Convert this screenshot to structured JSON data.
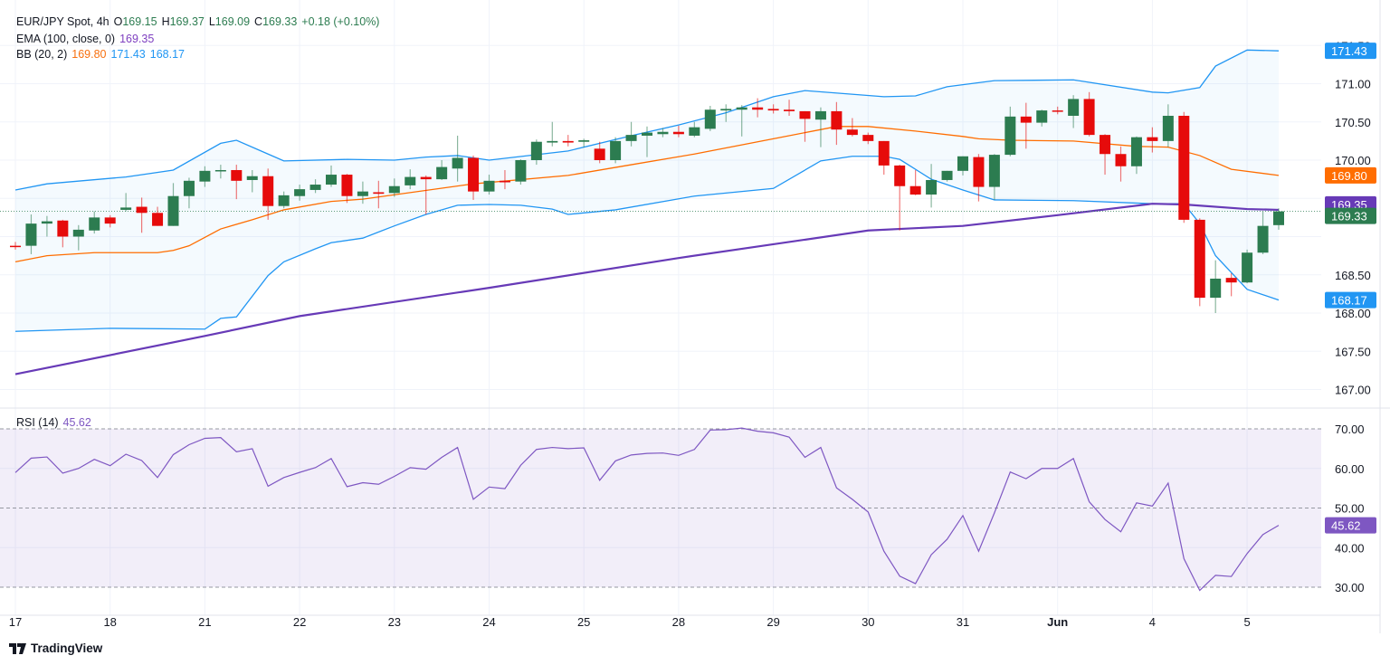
{
  "legend": {
    "symbol": "EUR/JPY Spot, 4h",
    "o_label": "O",
    "open": "169.15",
    "h_label": "H",
    "high": "169.37",
    "l_label": "L",
    "low": "169.09",
    "c_label": "C",
    "close": "169.33",
    "change": "+0.18 (+0.10%)",
    "ema_label": "EMA (100, close, 0)",
    "ema_value": "169.35",
    "bb_label": "BB (20, 2)",
    "bb_basis": "169.80",
    "bb_upper": "171.43",
    "bb_lower": "168.17",
    "rsi_label": "RSI (14)",
    "rsi_value": "45.62"
  },
  "branding": {
    "name": "TradingView"
  },
  "colors": {
    "up": "#2c7c50",
    "down": "#e60b0b",
    "bb_band": "#2196f3",
    "bb_basis": "#ff6d00",
    "ema": "#673ab7",
    "rsi": "#7e57c2"
  },
  "chart_data": [
    {
      "type": "candlestick",
      "x_tick_labels": [
        "17",
        "18",
        "21",
        "22",
        "23",
        "24",
        "25",
        "28",
        "29",
        "30",
        "31",
        "Jun",
        "4",
        "5"
      ],
      "y_tick_labels": [
        "171.50",
        "171.00",
        "170.50",
        "170.00",
        "168.50",
        "168.00",
        "167.50",
        "167.00"
      ],
      "ylim": [
        166.8,
        171.6
      ],
      "grid": true,
      "price_labels": {
        "bb_upper": "171.43",
        "bb_basis": "169.80",
        "ema": "169.35",
        "last": "169.33",
        "bb_lower": "168.17"
      },
      "candles_ohlc": [
        [
          168.88,
          168.93,
          168.83,
          168.87
        ],
        [
          168.88,
          169.29,
          168.77,
          169.17
        ],
        [
          169.17,
          169.27,
          169.0,
          169.2
        ],
        [
          169.21,
          169.22,
          168.86,
          169.0
        ],
        [
          169.0,
          169.15,
          168.82,
          169.09
        ],
        [
          169.08,
          169.33,
          169.04,
          169.25
        ],
        [
          169.25,
          169.28,
          169.12,
          169.17
        ],
        [
          169.35,
          169.57,
          169.33,
          169.38
        ],
        [
          169.39,
          169.51,
          169.05,
          169.31
        ],
        [
          169.31,
          169.39,
          169.14,
          169.14
        ],
        [
          169.14,
          169.7,
          169.14,
          169.53
        ],
        [
          169.53,
          169.77,
          169.37,
          169.73
        ],
        [
          169.72,
          169.92,
          169.65,
          169.86
        ],
        [
          169.86,
          169.94,
          169.76,
          169.87
        ],
        [
          169.87,
          169.94,
          169.49,
          169.73
        ],
        [
          169.74,
          169.87,
          169.58,
          169.79
        ],
        [
          169.79,
          169.89,
          169.22,
          169.4
        ],
        [
          169.4,
          169.59,
          169.37,
          169.54
        ],
        [
          169.53,
          169.68,
          169.47,
          169.62
        ],
        [
          169.61,
          169.75,
          169.57,
          169.68
        ],
        [
          169.68,
          169.93,
          169.65,
          169.81
        ],
        [
          169.81,
          169.82,
          169.44,
          169.53
        ],
        [
          169.53,
          169.72,
          169.43,
          169.59
        ],
        [
          169.58,
          169.73,
          169.37,
          169.56
        ],
        [
          169.57,
          169.76,
          169.52,
          169.66
        ],
        [
          169.67,
          169.88,
          169.62,
          169.78
        ],
        [
          169.78,
          169.8,
          169.29,
          169.75
        ],
        [
          169.75,
          170.0,
          169.74,
          169.91
        ],
        [
          169.89,
          170.32,
          169.72,
          170.03
        ],
        [
          170.03,
          170.06,
          169.48,
          169.59
        ],
        [
          169.59,
          169.81,
          169.55,
          169.73
        ],
        [
          169.73,
          169.87,
          169.62,
          169.71
        ],
        [
          169.72,
          170.01,
          169.68,
          170.0
        ],
        [
          170.0,
          170.27,
          169.94,
          170.24
        ],
        [
          170.23,
          170.5,
          170.18,
          170.25
        ],
        [
          170.25,
          170.33,
          170.18,
          170.23
        ],
        [
          170.24,
          170.28,
          170.17,
          170.26
        ],
        [
          170.15,
          170.24,
          169.96,
          170.0
        ],
        [
          170.0,
          170.3,
          169.96,
          170.25
        ],
        [
          170.25,
          170.5,
          170.18,
          170.33
        ],
        [
          170.32,
          170.44,
          170.04,
          170.36
        ],
        [
          170.34,
          170.42,
          170.3,
          170.37
        ],
        [
          170.37,
          170.45,
          170.3,
          170.34
        ],
        [
          170.32,
          170.5,
          170.3,
          170.43
        ],
        [
          170.41,
          170.71,
          170.38,
          170.66
        ],
        [
          170.65,
          170.73,
          170.5,
          170.67
        ],
        [
          170.66,
          170.72,
          170.31,
          170.69
        ],
        [
          170.69,
          170.81,
          170.56,
          170.66
        ],
        [
          170.67,
          170.73,
          170.61,
          170.65
        ],
        [
          170.66,
          170.79,
          170.58,
          170.64
        ],
        [
          170.64,
          170.64,
          170.24,
          170.54
        ],
        [
          170.53,
          170.69,
          170.17,
          170.64
        ],
        [
          170.64,
          170.76,
          170.2,
          170.4
        ],
        [
          170.4,
          170.55,
          170.31,
          170.33
        ],
        [
          170.33,
          170.36,
          170.21,
          170.25
        ],
        [
          170.25,
          170.25,
          169.81,
          169.93
        ],
        [
          169.93,
          169.94,
          169.08,
          169.66
        ],
        [
          169.66,
          169.87,
          169.54,
          169.55
        ],
        [
          169.55,
          169.95,
          169.38,
          169.74
        ],
        [
          169.74,
          169.86,
          169.72,
          169.86
        ],
        [
          169.86,
          170.05,
          169.8,
          170.05
        ],
        [
          170.04,
          170.08,
          169.46,
          169.65
        ],
        [
          169.65,
          170.08,
          169.48,
          170.07
        ],
        [
          170.07,
          170.7,
          170.05,
          170.57
        ],
        [
          170.57,
          170.75,
          170.15,
          170.49
        ],
        [
          170.49,
          170.66,
          170.44,
          170.65
        ],
        [
          170.65,
          170.7,
          170.6,
          170.64
        ],
        [
          170.58,
          170.85,
          170.42,
          170.8
        ],
        [
          170.8,
          170.89,
          170.31,
          170.33
        ],
        [
          170.33,
          170.34,
          169.81,
          170.08
        ],
        [
          170.08,
          170.18,
          169.72,
          169.92
        ],
        [
          169.92,
          170.31,
          169.82,
          170.3
        ],
        [
          170.3,
          170.43,
          170.1,
          170.25
        ],
        [
          170.25,
          170.73,
          170.17,
          170.58
        ],
        [
          170.58,
          170.63,
          169.18,
          169.22
        ],
        [
          169.22,
          169.24,
          168.09,
          168.2
        ],
        [
          168.2,
          168.69,
          168.0,
          168.45
        ],
        [
          168.46,
          168.52,
          168.22,
          168.4
        ],
        [
          168.4,
          168.83,
          168.39,
          168.79
        ],
        [
          168.79,
          169.33,
          168.77,
          169.14
        ],
        [
          169.15,
          169.37,
          169.09,
          169.33
        ]
      ],
      "bb_upper": [
        [
          0,
          169.61
        ],
        [
          2,
          169.69
        ],
        [
          7,
          169.78
        ],
        [
          10,
          169.87
        ],
        [
          13,
          170.22
        ],
        [
          14,
          170.26
        ],
        [
          16,
          170.08
        ],
        [
          17,
          169.99
        ],
        [
          21,
          170.01
        ],
        [
          24,
          170.0
        ],
        [
          26,
          170.04
        ],
        [
          28,
          170.06
        ],
        [
          30,
          170.0
        ],
        [
          35,
          170.12
        ],
        [
          39,
          170.32
        ],
        [
          42,
          170.46
        ],
        [
          45,
          170.62
        ],
        [
          48,
          170.83
        ],
        [
          50,
          170.91
        ],
        [
          55,
          170.83
        ],
        [
          57,
          170.84
        ],
        [
          59,
          170.96
        ],
        [
          62,
          171.04
        ],
        [
          67,
          171.05
        ],
        [
          72,
          170.89
        ],
        [
          73,
          170.88
        ],
        [
          75,
          170.95
        ],
        [
          76,
          171.23
        ],
        [
          78,
          171.44
        ],
        [
          80,
          171.43
        ]
      ],
      "bb_basis": [
        [
          0,
          168.67
        ],
        [
          2,
          168.75
        ],
        [
          5,
          168.79
        ],
        [
          9,
          168.79
        ],
        [
          10,
          168.82
        ],
        [
          11,
          168.88
        ],
        [
          13,
          169.1
        ],
        [
          15,
          169.22
        ],
        [
          17,
          169.35
        ],
        [
          20,
          169.46
        ],
        [
          22,
          169.49
        ],
        [
          29,
          169.69
        ],
        [
          35,
          169.8
        ],
        [
          39,
          169.94
        ],
        [
          43,
          170.08
        ],
        [
          48,
          170.28
        ],
        [
          52,
          170.44
        ],
        [
          54,
          170.44
        ],
        [
          57,
          170.38
        ],
        [
          60,
          170.31
        ],
        [
          61,
          170.28
        ],
        [
          63,
          170.26
        ],
        [
          67,
          170.25
        ],
        [
          71,
          170.18
        ],
        [
          73,
          170.17
        ],
        [
          75,
          170.06
        ],
        [
          77,
          169.88
        ],
        [
          80,
          169.8
        ]
      ],
      "bb_lower": [
        [
          0,
          167.76
        ],
        [
          6,
          167.8
        ],
        [
          12,
          167.79
        ],
        [
          13,
          167.93
        ],
        [
          14,
          167.95
        ],
        [
          16,
          168.49
        ],
        [
          17,
          168.67
        ],
        [
          19,
          168.84
        ],
        [
          20,
          168.92
        ],
        [
          22,
          168.98
        ],
        [
          24,
          169.14
        ],
        [
          26,
          169.29
        ],
        [
          28,
          169.41
        ],
        [
          30,
          169.42
        ],
        [
          32,
          169.41
        ],
        [
          34,
          169.36
        ],
        [
          35,
          169.29
        ],
        [
          38,
          169.35
        ],
        [
          43,
          169.53
        ],
        [
          48,
          169.63
        ],
        [
          51,
          169.99
        ],
        [
          53,
          170.05
        ],
        [
          55,
          170.05
        ],
        [
          56,
          170.01
        ],
        [
          58,
          169.75
        ],
        [
          60,
          169.61
        ],
        [
          62,
          169.48
        ],
        [
          67,
          169.47
        ],
        [
          72,
          169.43
        ],
        [
          74,
          169.43
        ],
        [
          75,
          169.17
        ],
        [
          76,
          168.75
        ],
        [
          78,
          168.31
        ],
        [
          80,
          168.17
        ]
      ],
      "ema100": [
        [
          0,
          167.2
        ],
        [
          12,
          167.7
        ],
        [
          18,
          167.96
        ],
        [
          30,
          168.33
        ],
        [
          42,
          168.72
        ],
        [
          54,
          169.08
        ],
        [
          60,
          169.14
        ],
        [
          66,
          169.28
        ],
        [
          72,
          169.43
        ],
        [
          74,
          169.42
        ],
        [
          78,
          169.36
        ],
        [
          80,
          169.35
        ]
      ]
    },
    {
      "type": "line",
      "name": "RSI (14)",
      "ylim": [
        26,
        72
      ],
      "y_tick_labels": [
        "70.00",
        "60.00",
        "50.00",
        "40.00",
        "30.00"
      ],
      "levels": [
        70,
        50,
        30
      ],
      "last_label": "45.62",
      "values": [
        58.95,
        62.6,
        62.9,
        58.8,
        60.0,
        62.3,
        60.7,
        63.6,
        62.0,
        57.7,
        63.5,
        66.0,
        67.6,
        67.8,
        64.2,
        65.0,
        55.5,
        57.7,
        59.0,
        60.2,
        62.5,
        55.4,
        56.4,
        56.0,
        58.0,
        60.2,
        59.8,
        62.8,
        65.3,
        52.2,
        55.3,
        54.9,
        60.8,
        64.8,
        65.3,
        65.0,
        65.2,
        57.0,
        61.9,
        63.4,
        63.8,
        63.9,
        63.3,
        64.8,
        69.7,
        69.8,
        70.2,
        69.4,
        69.0,
        67.9,
        62.8,
        65.3,
        55.1,
        52.2,
        49.0,
        39.1,
        32.8,
        30.9,
        38.2,
        42.1,
        48.1,
        39.1,
        48.8,
        59.1,
        57.4,
        60.0,
        60.0,
        62.5,
        51.6,
        47.1,
        44.0,
        51.3,
        50.5,
        56.3,
        37.2,
        29.2,
        33.0,
        32.7,
        38.5,
        43.3,
        45.62
      ]
    }
  ]
}
